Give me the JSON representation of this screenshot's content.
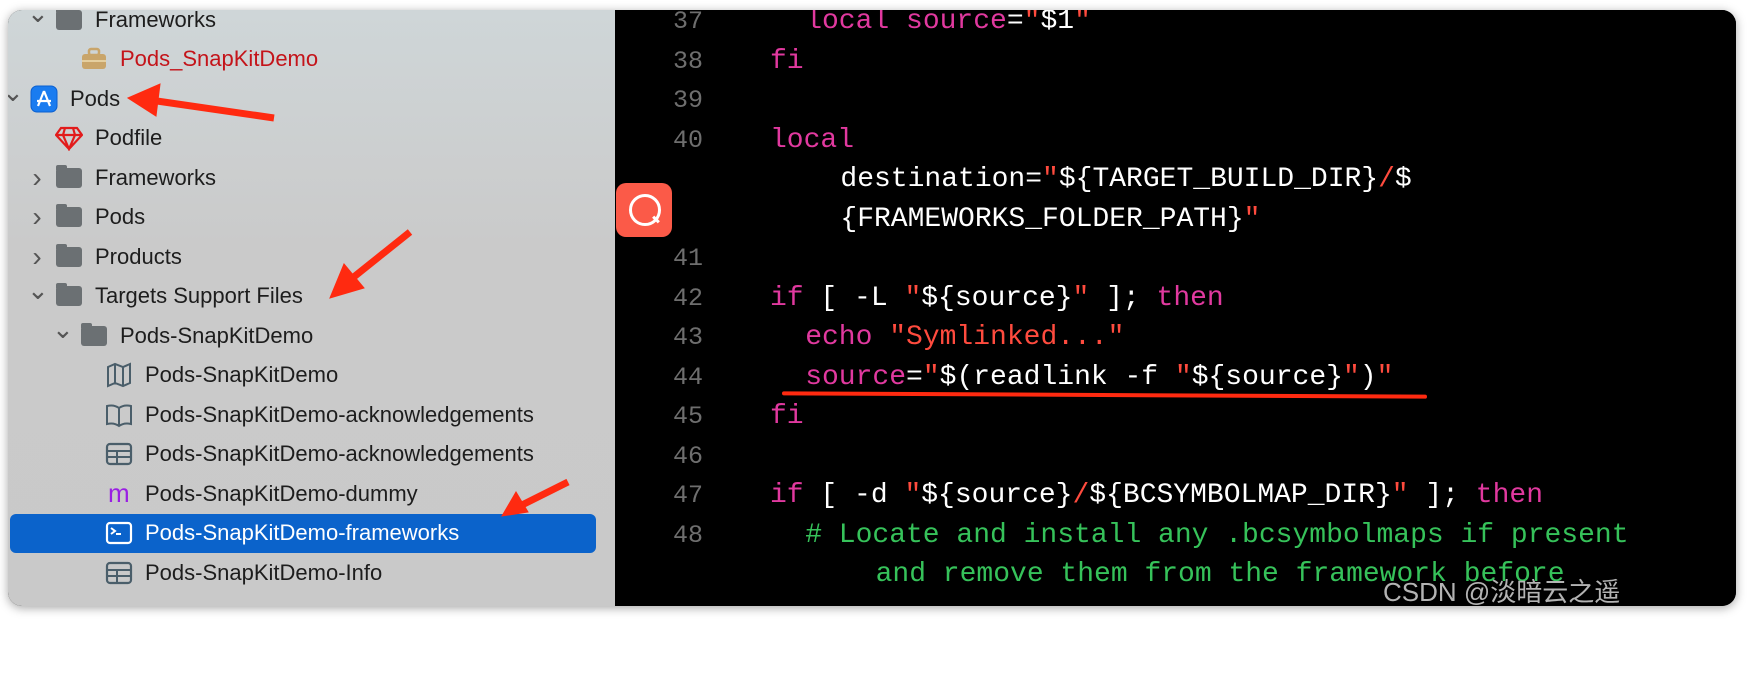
{
  "navigator": {
    "items": [
      {
        "label": "Frameworks",
        "icon": "folder-icon",
        "disclosure": "expanded",
        "indent": 1,
        "color": "#1d1d1d"
      },
      {
        "label": "Pods_SnapKitDemo",
        "icon": "toolbox-icon",
        "disclosure": "none",
        "indent": 2,
        "color": "#c4141a"
      },
      {
        "label": "Pods",
        "icon": "app-store-project-icon",
        "disclosure": "expanded",
        "indent": 0,
        "color": "#1d1d1d"
      },
      {
        "label": "Podfile",
        "icon": "ruby-gem-icon",
        "disclosure": "none",
        "indent": 1,
        "color": "#1d1d1d"
      },
      {
        "label": "Frameworks",
        "icon": "folder-icon",
        "disclosure": "collapsed",
        "indent": 1,
        "color": "#1d1d1d"
      },
      {
        "label": "Pods",
        "icon": "folder-icon",
        "disclosure": "collapsed",
        "indent": 1,
        "color": "#1d1d1d"
      },
      {
        "label": "Products",
        "icon": "folder-icon",
        "disclosure": "collapsed",
        "indent": 1,
        "color": "#1d1d1d"
      },
      {
        "label": "Targets Support Files",
        "icon": "folder-icon",
        "disclosure": "expanded",
        "indent": 1,
        "color": "#1d1d1d"
      },
      {
        "label": "Pods-SnapKitDemo",
        "icon": "folder-icon",
        "disclosure": "expanded",
        "indent": 2,
        "color": "#1d1d1d"
      },
      {
        "label": "Pods-SnapKitDemo",
        "icon": "module-map-icon",
        "disclosure": "none",
        "indent": 3,
        "color": "#1d1d1d"
      },
      {
        "label": "Pods-SnapKitDemo-acknowledgements",
        "icon": "book-icon",
        "disclosure": "none",
        "indent": 3,
        "color": "#1d1d1d"
      },
      {
        "label": "Pods-SnapKitDemo-acknowledgements",
        "icon": "plist-table-icon",
        "disclosure": "none",
        "indent": 3,
        "color": "#1d1d1d"
      },
      {
        "label": "Pods-SnapKitDemo-dummy",
        "icon": "objc-m-file-icon",
        "disclosure": "none",
        "indent": 3,
        "color": "#1d1d1d"
      },
      {
        "label": "Pods-SnapKitDemo-frameworks",
        "icon": "terminal-script-icon",
        "disclosure": "none",
        "indent": 3,
        "color": "#ffffff",
        "selected": true
      },
      {
        "label": "Pods-SnapKitDemo-Info",
        "icon": "plist-table-icon",
        "disclosure": "none",
        "indent": 3,
        "color": "#1d1d1d"
      }
    ],
    "selection_color": "#0b63cb"
  },
  "editor": {
    "colors": {
      "keyword": "#e1399f",
      "string": "#ff4b3e",
      "plain": "#ffffff",
      "comment": "#36c25a",
      "line_number": "#6e6e6e"
    },
    "lines": [
      {
        "num": "37",
        "indent": 2,
        "tokens": [
          {
            "t": "local",
            "c": "k"
          },
          {
            "t": " ",
            "c": "w"
          },
          {
            "t": "source",
            "c": "k"
          },
          {
            "t": "=",
            "c": "w"
          },
          {
            "t": "\"",
            "c": "s"
          },
          {
            "t": "$1",
            "c": "w"
          },
          {
            "t": "\"",
            "c": "s"
          }
        ]
      },
      {
        "num": "38",
        "indent": 0,
        "tokens": [
          {
            "t": "fi",
            "c": "k"
          }
        ]
      },
      {
        "num": "39",
        "indent": 0,
        "tokens": []
      },
      {
        "num": "40",
        "indent": 0,
        "tokens": [
          {
            "t": "local",
            "c": "k"
          }
        ]
      },
      {
        "num": "",
        "indent": 4,
        "tokens": [
          {
            "t": "destination=",
            "c": "w"
          },
          {
            "t": "\"",
            "c": "s"
          },
          {
            "t": "${TARGET_BUILD_DIR}",
            "c": "w"
          },
          {
            "t": "/",
            "c": "s"
          },
          {
            "t": "$",
            "c": "w"
          }
        ]
      },
      {
        "num": "",
        "indent": 4,
        "tokens": [
          {
            "t": "{FRAMEWORKS_FOLDER_PATH}",
            "c": "w"
          },
          {
            "t": "\"",
            "c": "s"
          }
        ]
      },
      {
        "num": "41",
        "indent": 0,
        "tokens": []
      },
      {
        "num": "42",
        "indent": 0,
        "tokens": [
          {
            "t": "if",
            "c": "k"
          },
          {
            "t": " [ -L ",
            "c": "w"
          },
          {
            "t": "\"",
            "c": "s"
          },
          {
            "t": "${source}",
            "c": "w"
          },
          {
            "t": "\"",
            "c": "s"
          },
          {
            "t": " ]; ",
            "c": "w"
          },
          {
            "t": "then",
            "c": "k"
          }
        ]
      },
      {
        "num": "43",
        "indent": 2,
        "tokens": [
          {
            "t": "echo",
            "c": "k"
          },
          {
            "t": " ",
            "c": "w"
          },
          {
            "t": "\"Symlinked...\"",
            "c": "s"
          }
        ]
      },
      {
        "num": "44",
        "indent": 2,
        "tokens": [
          {
            "t": "source",
            "c": "k"
          },
          {
            "t": "=",
            "c": "w"
          },
          {
            "t": "\"",
            "c": "s"
          },
          {
            "t": "$(readlink -f ",
            "c": "w"
          },
          {
            "t": "\"",
            "c": "s"
          },
          {
            "t": "${source}",
            "c": "w"
          },
          {
            "t": "\"",
            "c": "s"
          },
          {
            "t": ")",
            "c": "w"
          },
          {
            "t": "\"",
            "c": "s"
          }
        ]
      },
      {
        "num": "45",
        "indent": 0,
        "tokens": [
          {
            "t": "fi",
            "c": "k"
          }
        ]
      },
      {
        "num": "46",
        "indent": 0,
        "tokens": []
      },
      {
        "num": "47",
        "indent": 0,
        "tokens": [
          {
            "t": "if",
            "c": "k"
          },
          {
            "t": " [ -d ",
            "c": "w"
          },
          {
            "t": "\"",
            "c": "s"
          },
          {
            "t": "${source}",
            "c": "w"
          },
          {
            "t": "/",
            "c": "s"
          },
          {
            "t": "${BCSYMBOLMAP_DIR}",
            "c": "w"
          },
          {
            "t": "\"",
            "c": "s"
          },
          {
            "t": " ]; ",
            "c": "w"
          },
          {
            "t": "then",
            "c": "k"
          }
        ]
      },
      {
        "num": "48",
        "indent": 2,
        "tokens": [
          {
            "t": "# Locate and install any .bcsymbolmaps if present",
            "c": "c"
          }
        ]
      },
      {
        "num": "",
        "indent": 6,
        "tokens": [
          {
            "t": "and remove them from the framework before",
            "c": "c"
          }
        ]
      }
    ]
  },
  "floating_badge": {
    "icon": "search-icon",
    "color": "#fb5a48"
  },
  "annotations": {
    "arrow_color": "#ff2a10"
  },
  "watermark": "CSDN @淡暗云之遥"
}
